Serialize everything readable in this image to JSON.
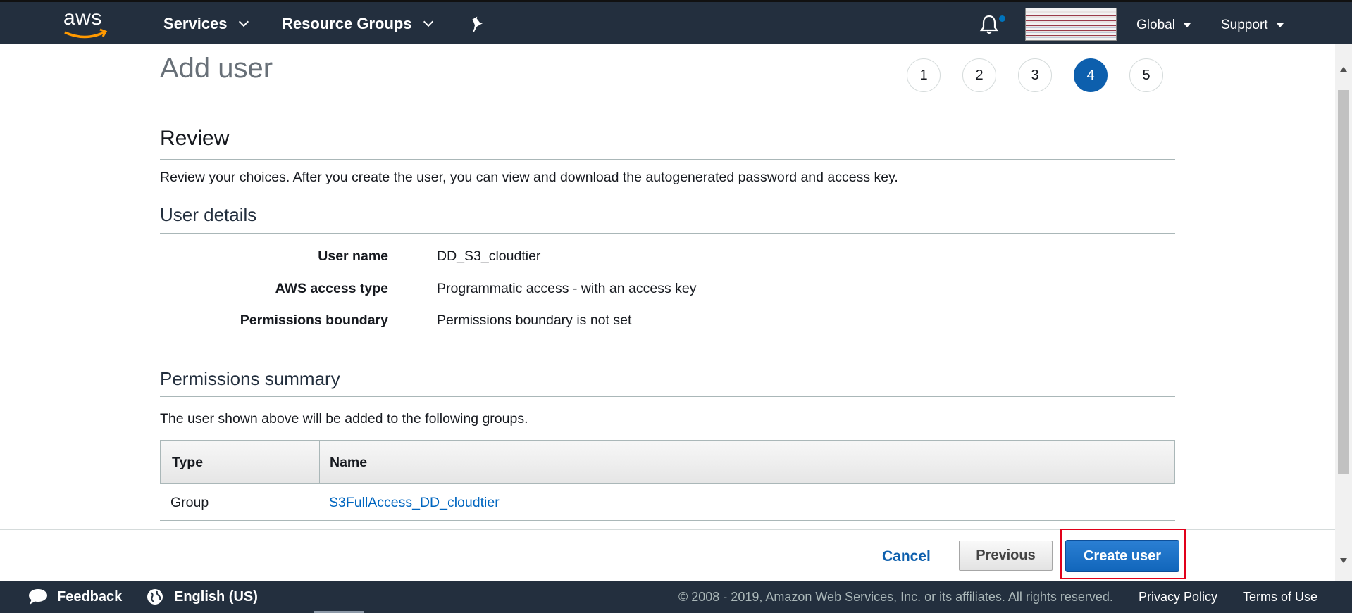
{
  "topnav": {
    "logo_text": "aws",
    "services_label": "Services",
    "resource_groups_label": "Resource Groups",
    "region_label": "Global",
    "support_label": "Support"
  },
  "page": {
    "title": "Add user",
    "steps": [
      "1",
      "2",
      "3",
      "4",
      "5"
    ],
    "active_step": "4"
  },
  "review": {
    "heading": "Review",
    "description": "Review your choices. After you create the user, you can view and download the autogenerated password and access key."
  },
  "user_details": {
    "heading": "User details",
    "rows": [
      {
        "label": "User name",
        "value": "DD_S3_cloudtier"
      },
      {
        "label": "AWS access type",
        "value": "Programmatic access - with an access key"
      },
      {
        "label": "Permissions boundary",
        "value": "Permissions boundary is not set"
      }
    ]
  },
  "permissions": {
    "heading": "Permissions summary",
    "description": "The user shown above will be added to the following groups.",
    "columns": [
      "Type",
      "Name"
    ],
    "rows": [
      {
        "type": "Group",
        "name": "S3FullAccess_DD_cloudtier"
      }
    ]
  },
  "actions": {
    "cancel": "Cancel",
    "previous": "Previous",
    "create": "Create user"
  },
  "footer": {
    "feedback": "Feedback",
    "language": "English (US)",
    "copyright": "© 2008 - 2019, Amazon Web Services, Inc. or its affiliates. All rights reserved.",
    "privacy": "Privacy Policy",
    "terms": "Terms of Use"
  },
  "colors": {
    "nav_bg": "#232f3e",
    "primary": "#1166bb",
    "link": "#0066c0",
    "highlight": "#e1001a"
  }
}
